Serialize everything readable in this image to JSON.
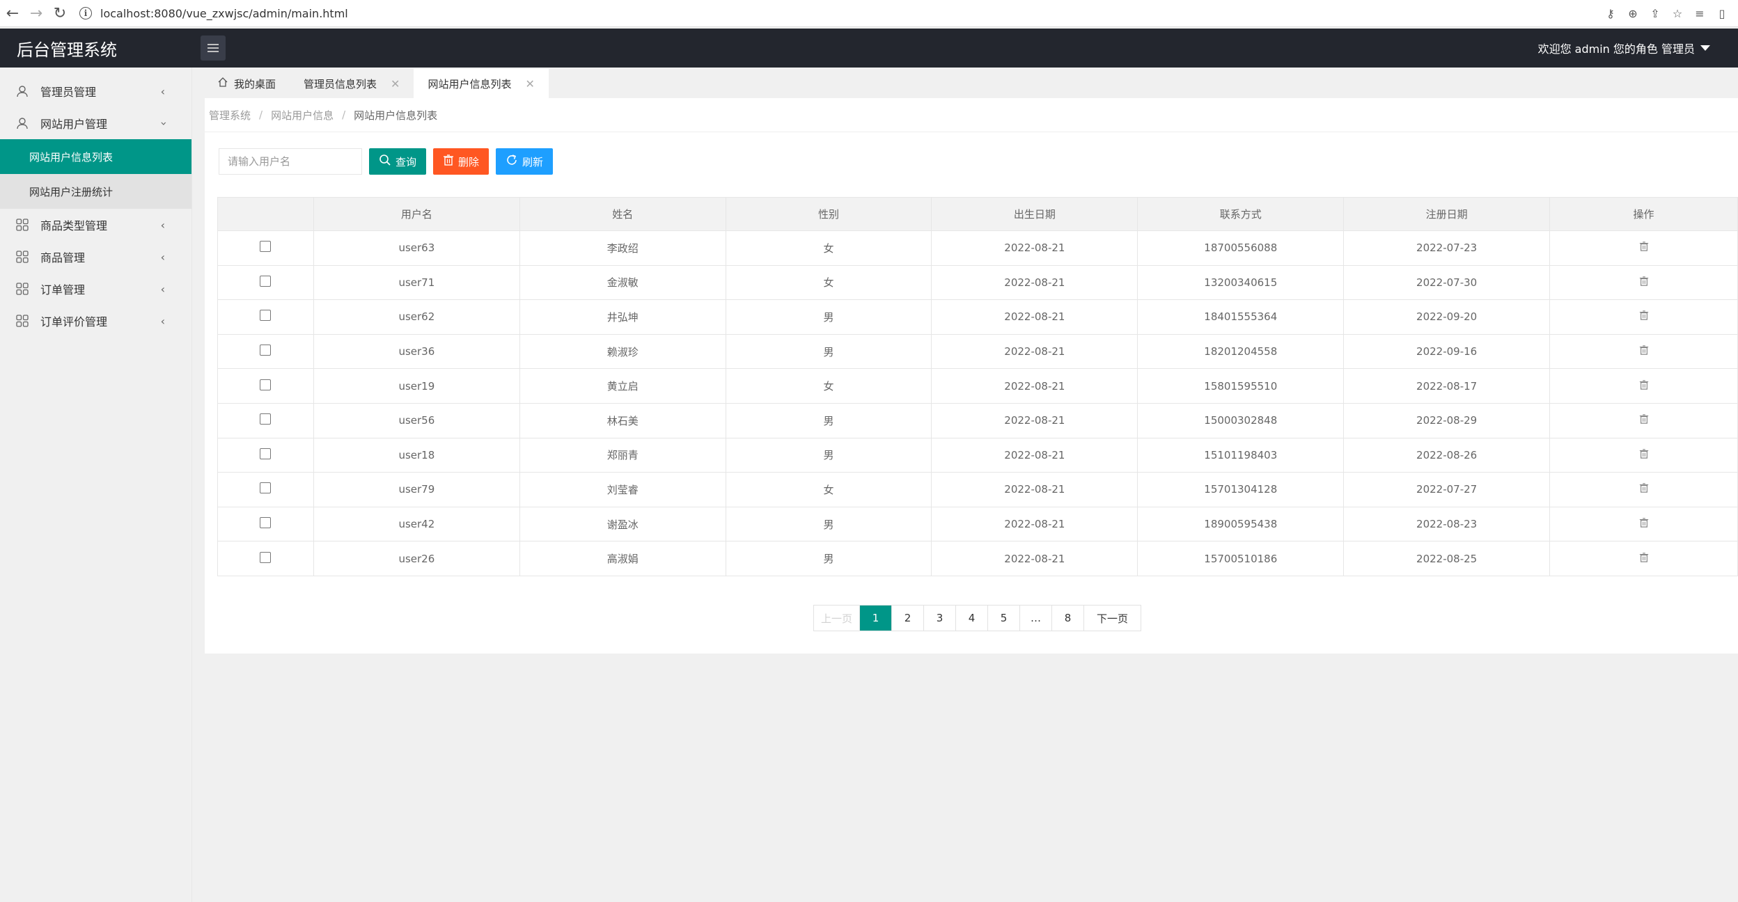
{
  "browser": {
    "url": "localhost:8080/vue_zxwjsc/admin/main.html"
  },
  "header": {
    "logo": "后台管理系统",
    "user_info": "欢迎您 admin 您的角色 管理员"
  },
  "sidebar": {
    "items": [
      {
        "label": "管理员管理"
      },
      {
        "label": "网站用户管理"
      },
      {
        "label": "商品类型管理"
      },
      {
        "label": "商品管理"
      },
      {
        "label": "订单管理"
      },
      {
        "label": "订单评价管理"
      }
    ],
    "sub_items": [
      {
        "label": "网站用户信息列表"
      },
      {
        "label": "网站用户注册统计"
      }
    ]
  },
  "tabs": [
    {
      "label": "我的桌面"
    },
    {
      "label": "管理员信息列表"
    },
    {
      "label": "网站用户信息列表"
    }
  ],
  "breadcrumb": {
    "items": [
      "管理系统",
      "网站用户信息",
      "网站用户信息列表"
    ],
    "separator": "/"
  },
  "toolbar": {
    "search_placeholder": "请输入用户名",
    "query_label": "查询",
    "delete_label": "删除",
    "refresh_label": "刷新"
  },
  "table": {
    "headers": [
      "",
      "用户名",
      "姓名",
      "性别",
      "出生日期",
      "联系方式",
      "注册日期",
      "操作"
    ],
    "rows": [
      [
        "user63",
        "李政绍",
        "女",
        "2022-08-21",
        "18700556088",
        "2022-07-23"
      ],
      [
        "user71",
        "金淑敏",
        "女",
        "2022-08-21",
        "13200340615",
        "2022-07-30"
      ],
      [
        "user62",
        "井弘坤",
        "男",
        "2022-08-21",
        "18401555364",
        "2022-09-20"
      ],
      [
        "user36",
        "赖淑珍",
        "男",
        "2022-08-21",
        "18201204558",
        "2022-09-16"
      ],
      [
        "user19",
        "黄立启",
        "女",
        "2022-08-21",
        "15801595510",
        "2022-08-17"
      ],
      [
        "user56",
        "林石美",
        "男",
        "2022-08-21",
        "15000302848",
        "2022-08-29"
      ],
      [
        "user18",
        "郑丽青",
        "男",
        "2022-08-21",
        "15101198403",
        "2022-08-26"
      ],
      [
        "user79",
        "刘莹睿",
        "女",
        "2022-08-21",
        "15701304128",
        "2022-07-27"
      ],
      [
        "user42",
        "谢盈冰",
        "男",
        "2022-08-21",
        "18900595438",
        "2022-08-23"
      ],
      [
        "user26",
        "高淑娟",
        "男",
        "2022-08-21",
        "15700510186",
        "2022-08-25"
      ]
    ]
  },
  "pager": {
    "prev": "上一页",
    "pages": [
      "1",
      "2",
      "3",
      "4",
      "5",
      "…",
      "8"
    ],
    "next": "下一页",
    "current": "1"
  },
  "colors": {
    "accent": "#009688",
    "danger": "#ff5722",
    "info": "#1e9fff",
    "header_bg": "#23262e"
  }
}
